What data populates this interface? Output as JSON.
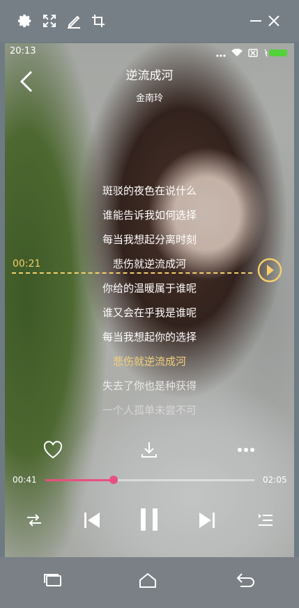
{
  "toolbar": {
    "icons": [
      "gear-icon",
      "fullscreen-icon",
      "edit-icon",
      "crop-icon",
      "minimize-icon",
      "close-icon"
    ]
  },
  "status_bar": {
    "time": "20:13",
    "icons": [
      "signal-icon",
      "wifi-icon",
      "no-sim-icon",
      "battery-icon"
    ],
    "battery_color": "#55d13b"
  },
  "player": {
    "title": "逆流成河",
    "artist": "金南玲",
    "lyrics": [
      "斑驳的夜色在说什么",
      "谁能告诉我如何选择",
      "每当我想起分离时刻",
      "悲伤就逆流成河",
      "你给的温暖属于谁呢",
      "谁又会在乎我是谁呢",
      "每当我想起你的选择",
      "悲伤就逆流成河",
      "失去了你也是种获得",
      "一个人孤单未尝不可"
    ],
    "active_lyric_index": 7,
    "seek_time": "00:21",
    "current_time": "00:41",
    "total_time": "02:05",
    "progress_fraction": 0.328,
    "accent_color": "#ea4f80",
    "highlight_color": "#f4d17b"
  },
  "actions": [
    "heart-icon",
    "download-icon",
    "more-icon"
  ],
  "controls": [
    "shuffle-icon",
    "previous-icon",
    "pause-icon",
    "next-icon",
    "playlist-icon"
  ],
  "nav_bar": [
    "recent-apps-icon",
    "home-icon",
    "back-icon"
  ]
}
